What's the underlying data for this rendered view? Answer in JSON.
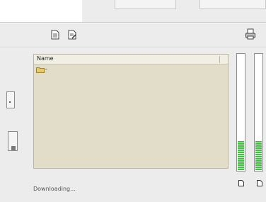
{
  "top": {
    "panel_color": "#ffffff"
  },
  "toolbar": {
    "left_icons": [
      "document-icon",
      "document-pencil-icon"
    ],
    "right_icon": "printer-icon"
  },
  "file_list": {
    "columns": [
      "Name"
    ],
    "rows": [
      {
        "icon": "folder-icon",
        "label": "-"
      }
    ]
  },
  "meters": [
    {
      "icon": "document-icon",
      "level": 0.25
    },
    {
      "icon": "document-icon",
      "level": 0.25
    }
  ],
  "status": {
    "text": "Downloading..."
  }
}
